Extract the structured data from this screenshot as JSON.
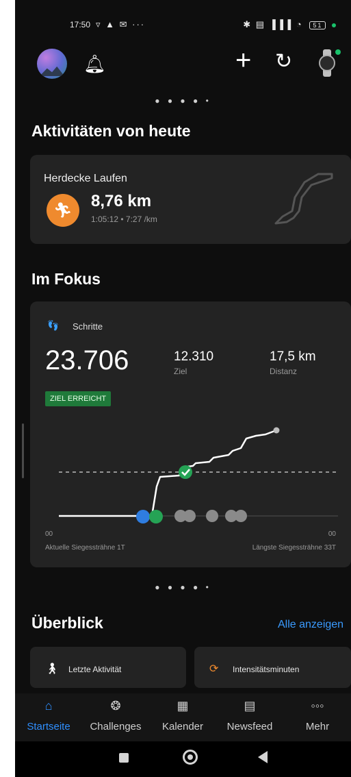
{
  "status": {
    "time": "17:50",
    "left_icons": "▿ ▲ ✉ ···",
    "right_icons": "✱ ▤ ▐▐▐ ◔",
    "battery": "51"
  },
  "header": {
    "avatar": "avatar",
    "bell_icon": "bell-icon",
    "plus_icon": "plus-icon",
    "sync_icon": "sync-icon",
    "watch_icon": "watch-icon"
  },
  "pager_top": "● ● ● ● •",
  "activities": {
    "section_title": "Aktivitäten von heute",
    "card": {
      "title": "Herdecke Laufen",
      "distance": "8,76 km",
      "sub": "1:05:12 • 7:27 /km",
      "icon": "running-icon",
      "icon_color": "#ef8a2e"
    }
  },
  "focus": {
    "section_title": "Im Fokus",
    "card": {
      "label": "Schritte",
      "steps": "23.706",
      "goal_value": "12.310",
      "goal_label": "Ziel",
      "distance_value": "17,5 km",
      "distance_label": "Distanz",
      "badge": "ZIEL ERREICHT",
      "axis_left": "00",
      "axis_right": "00",
      "streak_current": "Aktuelle Siegessträhne 1T",
      "streak_longest": "Längste Siegessträhne 33T"
    }
  },
  "pager_bottom": "● ● ● ● •",
  "overview": {
    "section_title": "Überblick",
    "link": "Alle anzeigen",
    "cards": [
      {
        "label": "Letzte Aktivität",
        "icon": "figure-icon"
      },
      {
        "label": "Intensitätsminuten",
        "icon": "intensity-icon"
      }
    ]
  },
  "nav": {
    "items": [
      {
        "label": "Startseite",
        "icon": "home-icon",
        "active": true
      },
      {
        "label": "Challenges",
        "icon": "challenges-icon",
        "active": false
      },
      {
        "label": "Kalender",
        "icon": "calendar-icon",
        "active": false
      },
      {
        "label": "Newsfeed",
        "icon": "newsfeed-icon",
        "active": false
      },
      {
        "label": "Mehr",
        "icon": "more-icon",
        "active": false
      }
    ]
  },
  "colors": {
    "accent": "#2f8fff",
    "goal_green": "#1f7a3a",
    "check_green": "#25a355"
  }
}
